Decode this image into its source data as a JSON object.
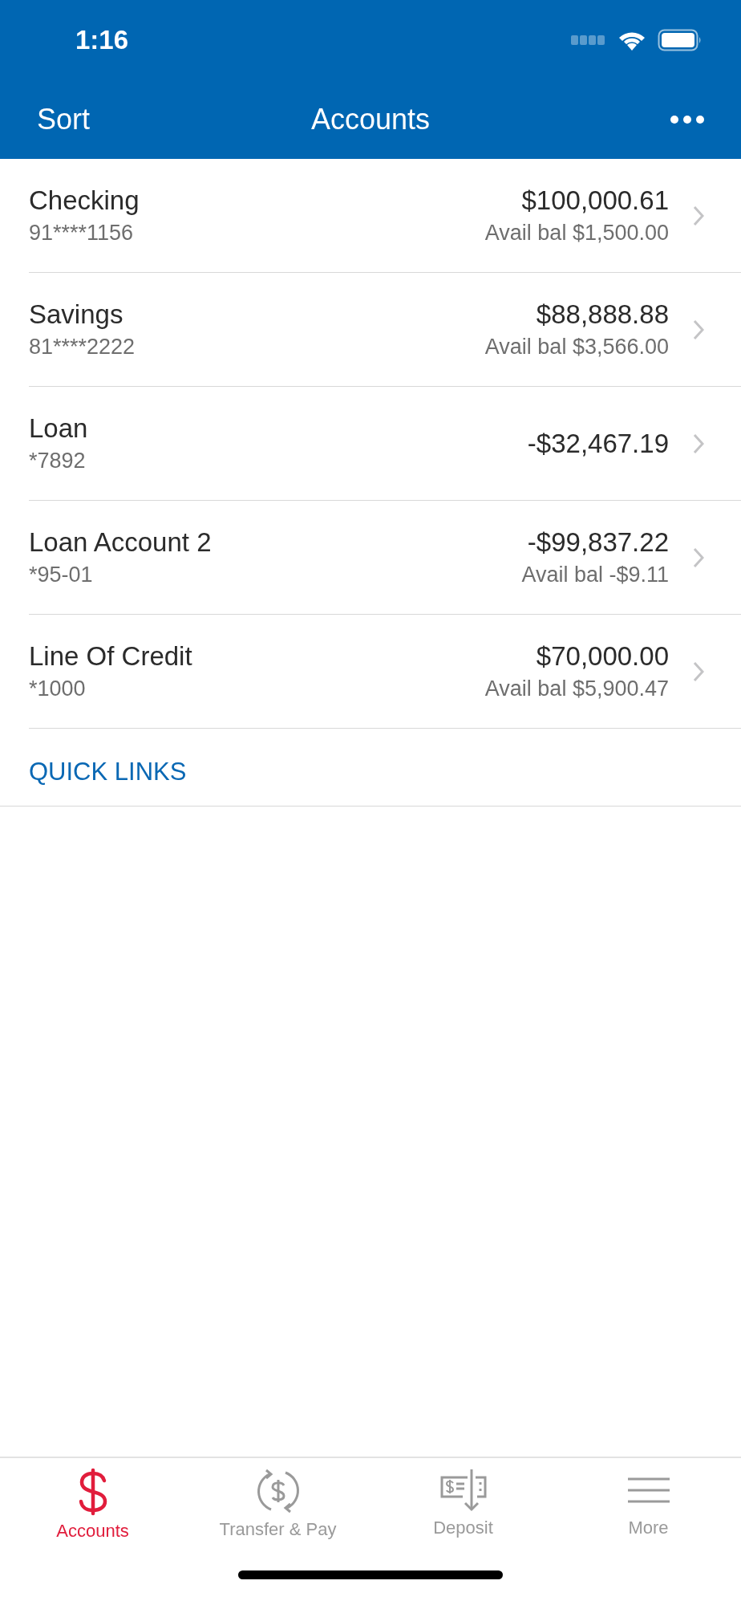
{
  "status_bar": {
    "time": "1:16"
  },
  "nav_bar": {
    "left": "Sort",
    "title": "Accounts"
  },
  "accounts": [
    {
      "name": "Checking",
      "number": "91****1156",
      "balance": "$100,000.61",
      "available": "Avail bal $1,500.00"
    },
    {
      "name": "Savings",
      "number": "81****2222",
      "balance": "$88,888.88",
      "available": "Avail bal $3,566.00"
    },
    {
      "name": "Loan",
      "number": "*7892",
      "balance": "-$32,467.19"
    },
    {
      "name": "Loan Account 2",
      "number": "*95-01",
      "balance": "-$99,837.22",
      "available": "Avail bal -$9.11"
    },
    {
      "name": "Line Of Credit",
      "number": "*1000",
      "balance": "$70,000.00",
      "available": "Avail bal $5,900.47"
    }
  ],
  "quick_links": {
    "title": "QUICK LINKS"
  },
  "tabs": [
    {
      "kind": "accounts",
      "label": "Accounts",
      "selected": true
    },
    {
      "kind": "transfer",
      "label": "Transfer & Pay",
      "selected": false
    },
    {
      "kind": "deposit",
      "label": "Deposit",
      "selected": false
    },
    {
      "kind": "more",
      "label": "More",
      "selected": false
    }
  ]
}
